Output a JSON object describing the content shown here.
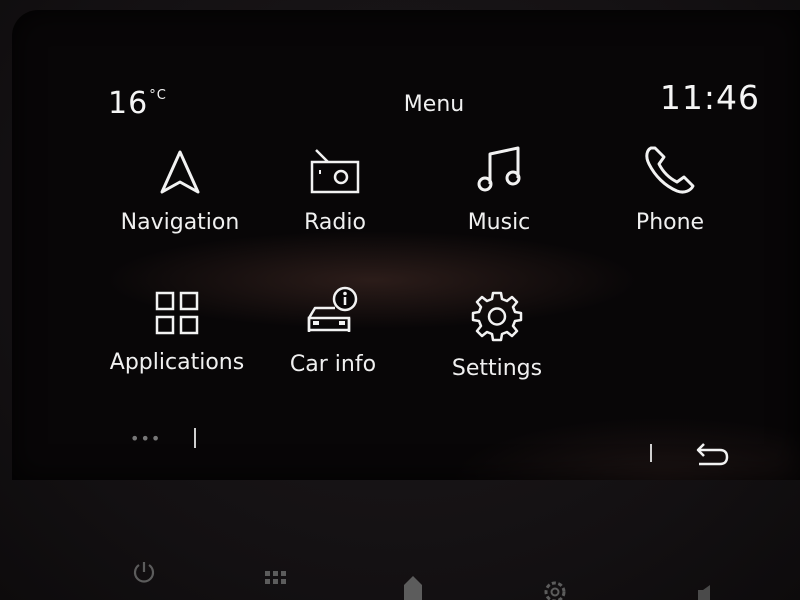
{
  "status_bar": {
    "temperature": "16",
    "temperature_unit": "°C",
    "title": "Menu",
    "time": "11:46"
  },
  "menu_items": [
    {
      "label": "Navigation",
      "icon": "navigation-arrow-icon"
    },
    {
      "label": "Radio",
      "icon": "radio-icon"
    },
    {
      "label": "Music",
      "icon": "music-note-icon"
    },
    {
      "label": "Phone",
      "icon": "phone-icon"
    },
    {
      "label": "Applications",
      "icon": "grid-apps-icon"
    },
    {
      "label": "Car info",
      "icon": "car-info-icon"
    },
    {
      "label": "Settings",
      "icon": "gear-icon"
    }
  ],
  "footer": {
    "more_indicator": "•••",
    "back_icon": "back-arrow-icon"
  },
  "hardware_buttons": [
    "power-icon",
    "grid-icon",
    "home-icon",
    "settings-icon",
    "volume-icon"
  ],
  "colors": {
    "screen_background": "#080607",
    "foreground": "#f0f0f0"
  }
}
